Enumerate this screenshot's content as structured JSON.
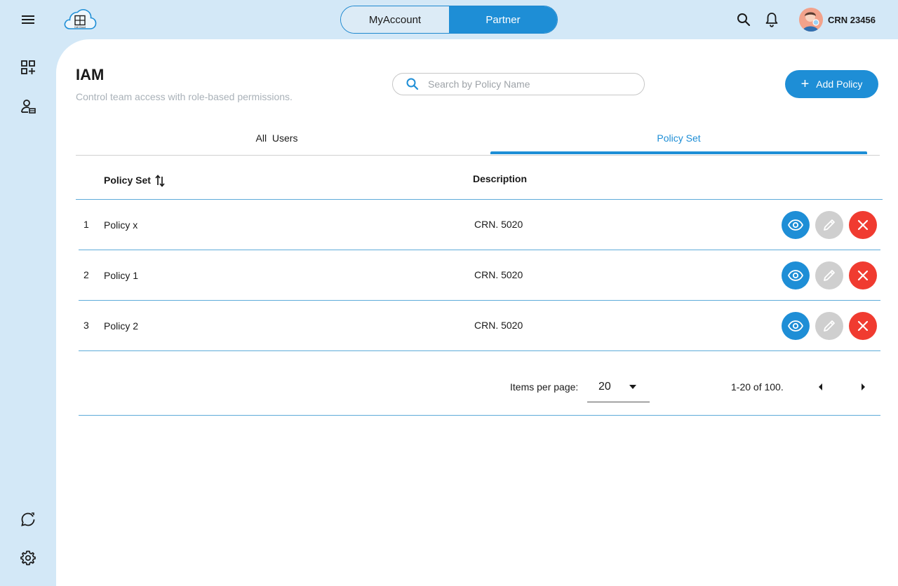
{
  "topbar": {
    "logo_text": "Cell Cloud",
    "toggle": [
      "MyAccount",
      "Partner"
    ],
    "active_toggle": "Partner",
    "crn_label": "CRN 23456",
    "icons": [
      "menu-icon",
      "search-icon",
      "bell-icon"
    ]
  },
  "sidenav": {
    "icons": [
      "dashboard-add-icon",
      "user-manage-icon",
      "chat-refresh-icon",
      "gear-icon"
    ]
  },
  "page": {
    "title": "IAM",
    "subtitle": "Control team access with role-based permissions."
  },
  "search": {
    "placeholder": "Search by Policy Name",
    "value": ""
  },
  "add_button": {
    "label": "Add Policy"
  },
  "tabs": {
    "items": [
      "All  Users",
      "Policy Set"
    ],
    "active": "Policy Set"
  },
  "table": {
    "headers": {
      "name": "Policy Set",
      "description": "Description"
    },
    "rows": [
      {
        "index": "1",
        "name": "Policy x",
        "description": "CRN. 5020"
      },
      {
        "index": "2",
        "name": "Policy 1",
        "description": "CRN. 5020"
      },
      {
        "index": "3",
        "name": "Policy 2",
        "description": "CRN. 5020"
      }
    ],
    "row_actions": [
      "eye-icon",
      "pencil-icon",
      "close-icon"
    ]
  },
  "pagination": {
    "items_per_page_label": "Items per page:",
    "items_per_page": "20",
    "range_label": "1-20 of 100."
  },
  "colors": {
    "primary": "#1e8ed6",
    "background": "#d3e8f7",
    "delete": "#f03b30",
    "edit": "#cfcfcf"
  }
}
